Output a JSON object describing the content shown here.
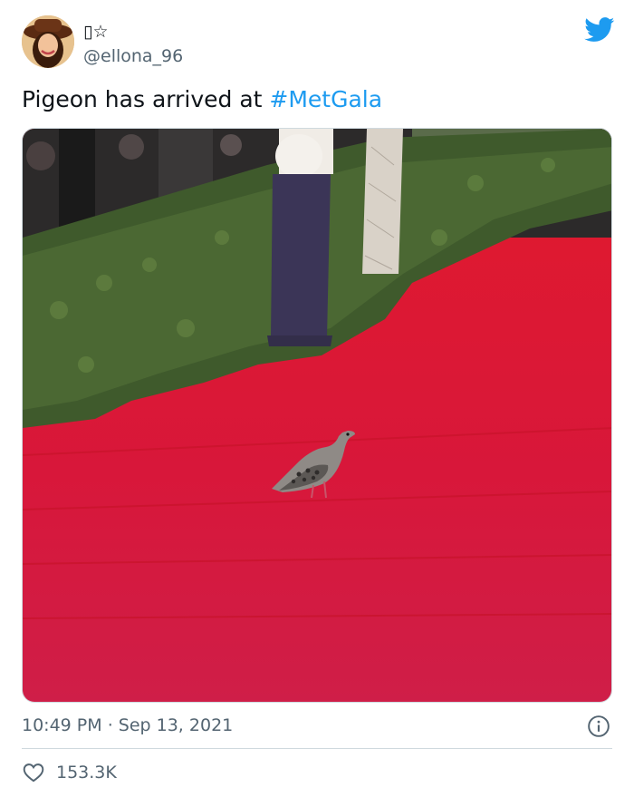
{
  "user": {
    "display_name": "▯☆",
    "handle": "@ellona_96"
  },
  "tweet": {
    "text": "Pigeon has arrived at ",
    "hashtag": "#MetGala"
  },
  "meta": {
    "time": "10:49 PM",
    "separator": " · ",
    "date": "Sep 13, 2021"
  },
  "engagement": {
    "likes": "153.3K"
  },
  "icons": {
    "brand": "twitter-bird-icon",
    "info": "info-icon",
    "like": "heart-icon"
  },
  "colors": {
    "brand": "#1d9bf0",
    "muted": "#536471",
    "text": "#0f1419",
    "carpet": "#d9182e"
  }
}
